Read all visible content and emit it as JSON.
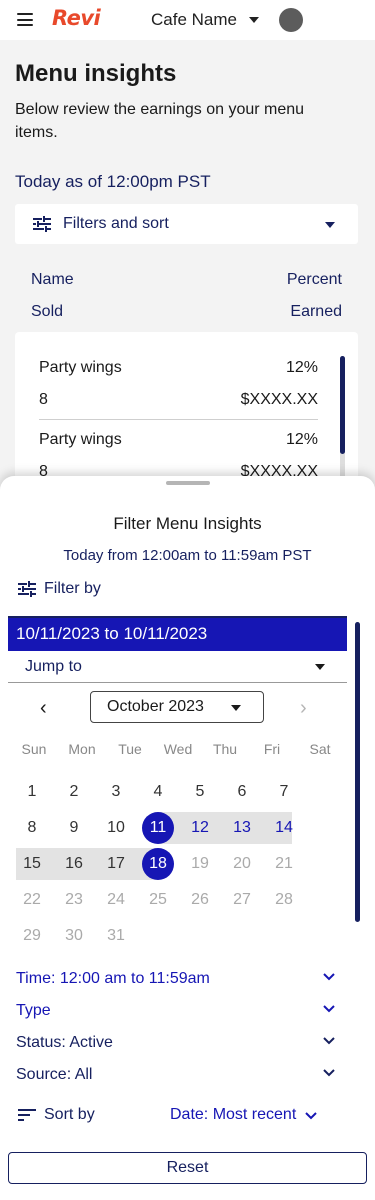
{
  "header": {
    "logo": "Revi",
    "cafe_name": "Cafe Name"
  },
  "page": {
    "title": "Menu insights",
    "description": "Below review the earnings on your menu items.",
    "today_label": "Today as of 12:00pm PST",
    "filters_label": "Filters and sort"
  },
  "columns": {
    "name": "Name",
    "percent": "Percent",
    "sold": "Sold",
    "earned": "Earned"
  },
  "items": [
    {
      "name": "Party wings",
      "percent": "12%",
      "sold": "8",
      "earned": "$XXXX.XX"
    },
    {
      "name": "Party wings",
      "percent": "12%",
      "sold": "8",
      "earned": "$XXXX.XX"
    }
  ],
  "sheet": {
    "title": "Filter Menu Insights",
    "subtitle": "Today from 12:00am to 11:59am PST",
    "filter_by": "Filter by",
    "date_range": "10/11/2023 to 10/11/2023",
    "jump_to": "Jump to",
    "month": "October 2023",
    "weekdays": [
      "Sun",
      "Mon",
      "Tue",
      "Wed",
      "Thu",
      "Fri",
      "Sat"
    ],
    "weeks": [
      [
        "1",
        "2",
        "3",
        "4",
        "5",
        "6",
        "7"
      ],
      [
        "8",
        "9",
        "10",
        "11",
        "12",
        "13",
        "14"
      ],
      [
        "15",
        "16",
        "17",
        "18",
        "19",
        "20",
        "21"
      ],
      [
        "22",
        "23",
        "24",
        "25",
        "26",
        "27",
        "28"
      ],
      [
        "29",
        "30",
        "31"
      ]
    ],
    "filters": {
      "time": "Time: 12:00 am to 11:59am",
      "type": "Type",
      "status": "Status: Active",
      "source": "Source: All"
    },
    "sort_by": "Sort by",
    "sort_value": "Date: Most recent",
    "reset": "Reset"
  },
  "colors": {
    "brand": "#e8492b",
    "accent": "#1616b4",
    "navy": "#16205f"
  }
}
